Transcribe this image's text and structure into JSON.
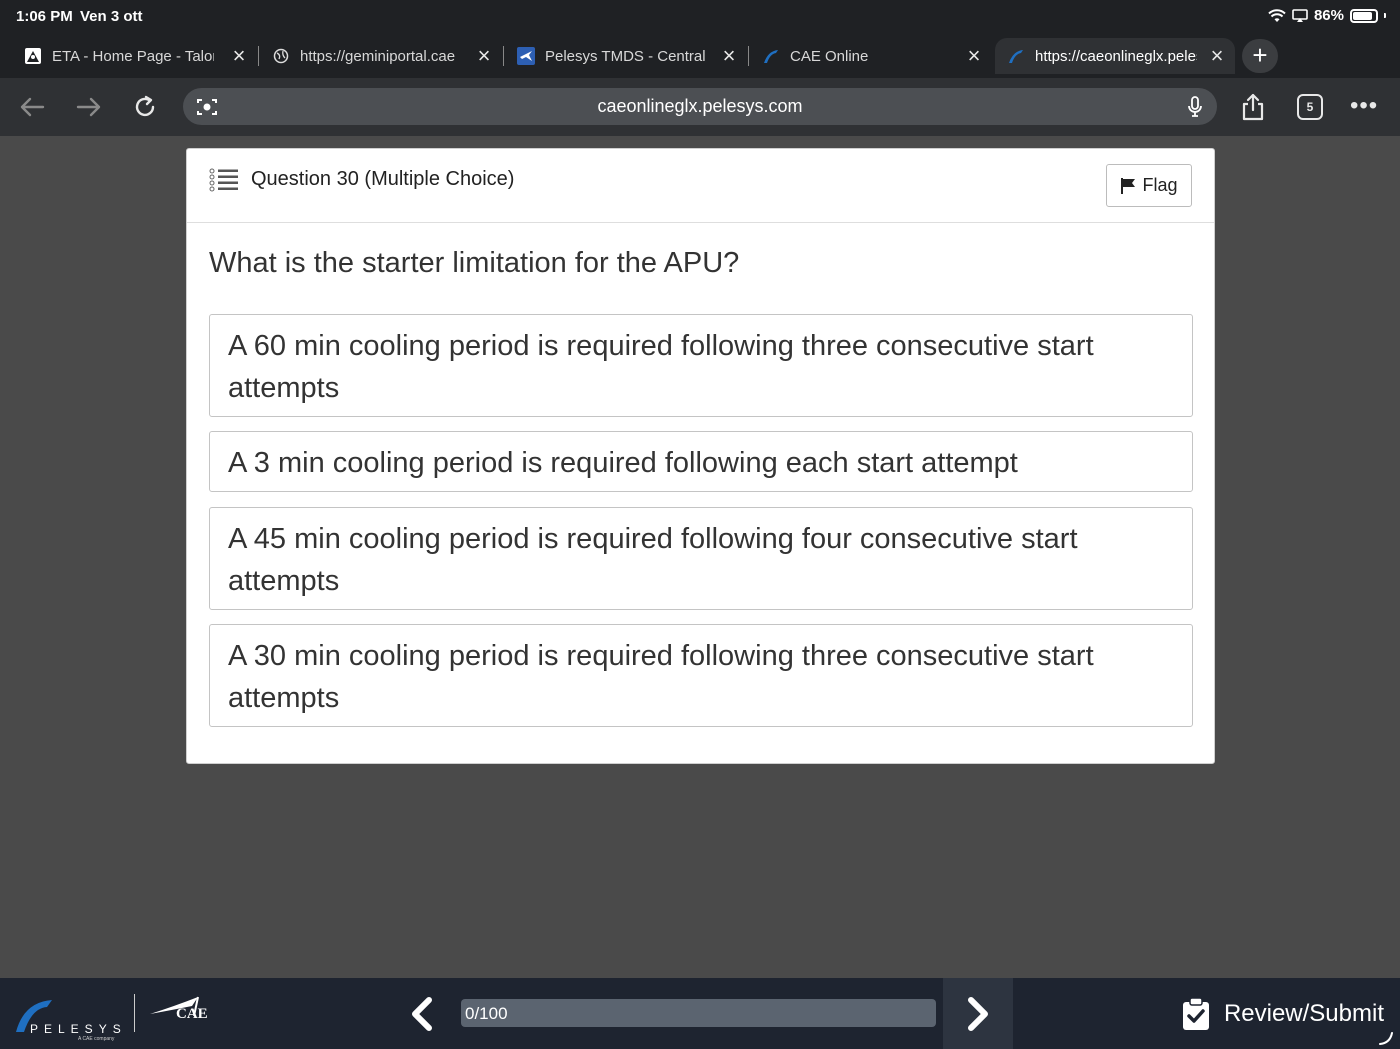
{
  "status": {
    "time": "1:06 PM",
    "date": "Ven 3 ott",
    "battery": "86%",
    "battery_level": 0.86
  },
  "tabs": [
    {
      "title": "ETA - Home Page - Talon",
      "icon": "eta-favicon-icon",
      "active": false
    },
    {
      "title": "https://geminiportal.cae",
      "icon": "globe-icon",
      "active": false
    },
    {
      "title": "Pelesys TMDS - Central",
      "icon": "airplane-favicon-icon",
      "active": false
    },
    {
      "title": "CAE Online",
      "icon": "pelesys-favicon-icon",
      "active": false
    },
    {
      "title": "https://caeonlineglx.pelesys",
      "icon": "pelesys-favicon-icon",
      "active": true
    }
  ],
  "toolbar": {
    "url": "caeonlineglx.pelesys.com",
    "tabs_count": "5"
  },
  "question": {
    "header": "Question 30 (Multiple Choice)",
    "flag_label": "Flag",
    "text": "What is the starter limitation for the APU?",
    "answers": [
      "A 60 min cooling period is required following three consecutive start attempts",
      "A 3 min cooling period is required following each start attempt",
      "A 45 min cooling period is required following four consecutive start attempts",
      "A 30 min cooling period is required following three consecutive start attempts"
    ]
  },
  "footer": {
    "brand_pelesys": "PELESYS",
    "brand_pelesys_sub": "A CAE company",
    "brand_cae": "CAE",
    "progress_text": "0/100",
    "progress_value": 0,
    "review_label": "Review/Submit"
  },
  "colors": {
    "chrome_dark": "#1f2124",
    "toolbar": "#2f3134",
    "page_bg": "#4a4a4a",
    "footer_bg": "#1e2430",
    "pelesys_blue": "#1f6fc1"
  }
}
